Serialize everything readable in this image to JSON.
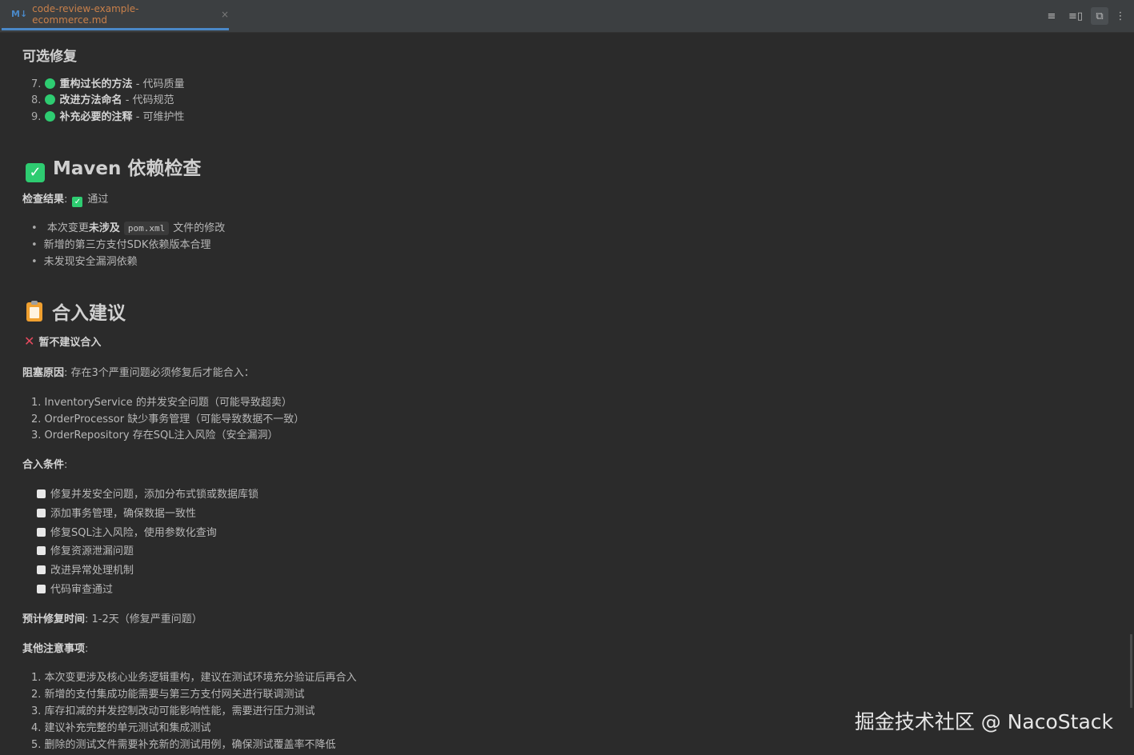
{
  "tab": {
    "icon": "M↓",
    "title": "code-review-example-ecommerce.md",
    "close": "×"
  },
  "toolbar": {
    "editor_only": "≡",
    "split": "≡▯",
    "preview": "⧉",
    "more": "⋮"
  },
  "optional": {
    "title": "可选修复",
    "items": [
      {
        "num": "7.",
        "bold": "重构过长的方法",
        "rest": " - 代码质量"
      },
      {
        "num": "8.",
        "bold": "改进方法命名",
        "rest": " - 代码规范"
      },
      {
        "num": "9.",
        "bold": "补充必要的注释",
        "rest": " - 可维护性"
      }
    ]
  },
  "maven": {
    "title": "Maven 依赖检查",
    "result_label": "检查结果",
    "result_sep": ":",
    "result_value": "通过",
    "check_mark": "✓",
    "b1_pre": "本次变更",
    "b1_bold": "未涉及",
    "b1_code": "pom.xml",
    "b1_post": "文件的修改",
    "b2": "新增的第三方支付SDK依赖版本合理",
    "b3": "未发现安全漏洞依赖"
  },
  "merge": {
    "title": "合入建议",
    "cross": "✕",
    "verdict": "暂不建议合入",
    "block_label": "阻塞原因",
    "block_text": ": 存在3个严重问题必须修复后才能合入：",
    "blocks": [
      {
        "num": "1.",
        "text": "InventoryService 的并发安全问题（可能导致超卖）"
      },
      {
        "num": "2.",
        "text": "OrderProcessor 缺少事务管理（可能导致数据不一致）"
      },
      {
        "num": "3.",
        "text": "OrderRepository 存在SQL注入风险（安全漏洞）"
      }
    ],
    "cond_label": "合入条件",
    "cond_sep": ":",
    "conditions": [
      "修复并发安全问题，添加分布式锁或数据库锁",
      "添加事务管理，确保数据一致性",
      "修复SQL注入风险，使用参数化查询",
      "修复资源泄漏问题",
      "改进异常处理机制",
      "代码审查通过"
    ],
    "time_label": "预计修复时间",
    "time_text": ": 1-2天（修复严重问题）",
    "notes_label": "其他注意事项",
    "notes_sep": ":",
    "notes": [
      {
        "num": "1.",
        "text": "本次变更涉及核心业务逻辑重构，建议在测试环境充分验证后再合入"
      },
      {
        "num": "2.",
        "text": "新增的支付集成功能需要与第三方支付网关进行联调测试"
      },
      {
        "num": "3.",
        "text": "库存扣减的并发控制改动可能影响性能，需要进行压力测试"
      },
      {
        "num": "4.",
        "text": "建议补充完整的单元测试和集成测试"
      },
      {
        "num": "5.",
        "text": "删除的测试文件需要补充新的测试用例，确保测试覆盖率不降低"
      }
    ]
  },
  "watermark": "掘金技术社区 @ NacoStack",
  "colors": {
    "bg": "#2b2b2b",
    "accent": "#4a88c7",
    "green": "#2ecc71",
    "red": "#e64a5f"
  }
}
